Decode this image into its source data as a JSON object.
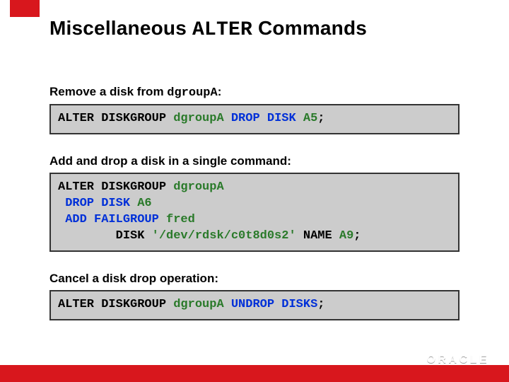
{
  "title": {
    "pre": "Miscellaneous ",
    "mono": "ALTER",
    "post": " Commands"
  },
  "sections": [
    {
      "caption_pre": "Remove a disk from ",
      "caption_mono": "dgroupA",
      "caption_post": ":",
      "code": [
        [
          {
            "t": "ALTER DISKGROUP ",
            "cls": ""
          },
          {
            "t": "dgroupA",
            "cls": "grn"
          },
          {
            "t": " ",
            "cls": ""
          },
          {
            "t": "DROP DISK",
            "cls": "kw"
          },
          {
            "t": " ",
            "cls": ""
          },
          {
            "t": "A5",
            "cls": "grn"
          },
          {
            "t": ";",
            "cls": ""
          }
        ]
      ]
    },
    {
      "caption_pre": "Add and drop a disk in a single command:",
      "caption_mono": "",
      "caption_post": "",
      "code": [
        [
          {
            "t": "ALTER DISKGROUP ",
            "cls": ""
          },
          {
            "t": "dgroupA",
            "cls": "grn"
          }
        ],
        [
          {
            "t": " ",
            "cls": ""
          },
          {
            "t": "DROP DISK",
            "cls": "kw"
          },
          {
            "t": " ",
            "cls": ""
          },
          {
            "t": "A6",
            "cls": "grn"
          }
        ],
        [
          {
            "t": " ",
            "cls": ""
          },
          {
            "t": "ADD FAILGROUP",
            "cls": "kw"
          },
          {
            "t": " ",
            "cls": ""
          },
          {
            "t": "fred",
            "cls": "grn"
          }
        ],
        [
          {
            "t": "        DISK ",
            "cls": ""
          },
          {
            "t": "'/dev/rdsk/c0t8d0s2'",
            "cls": "grn"
          },
          {
            "t": " NAME ",
            "cls": ""
          },
          {
            "t": "A9",
            "cls": "grn"
          },
          {
            "t": ";",
            "cls": ""
          }
        ]
      ]
    },
    {
      "caption_pre": "Cancel a disk drop operation:",
      "caption_mono": "",
      "caption_post": "",
      "code": [
        [
          {
            "t": "ALTER DISKGROUP ",
            "cls": ""
          },
          {
            "t": "dgroupA",
            "cls": "grn"
          },
          {
            "t": " ",
            "cls": ""
          },
          {
            "t": "UNDROP DISKS",
            "cls": "kw"
          },
          {
            "t": ";",
            "cls": ""
          }
        ]
      ]
    }
  ],
  "logo": "ORACLE"
}
